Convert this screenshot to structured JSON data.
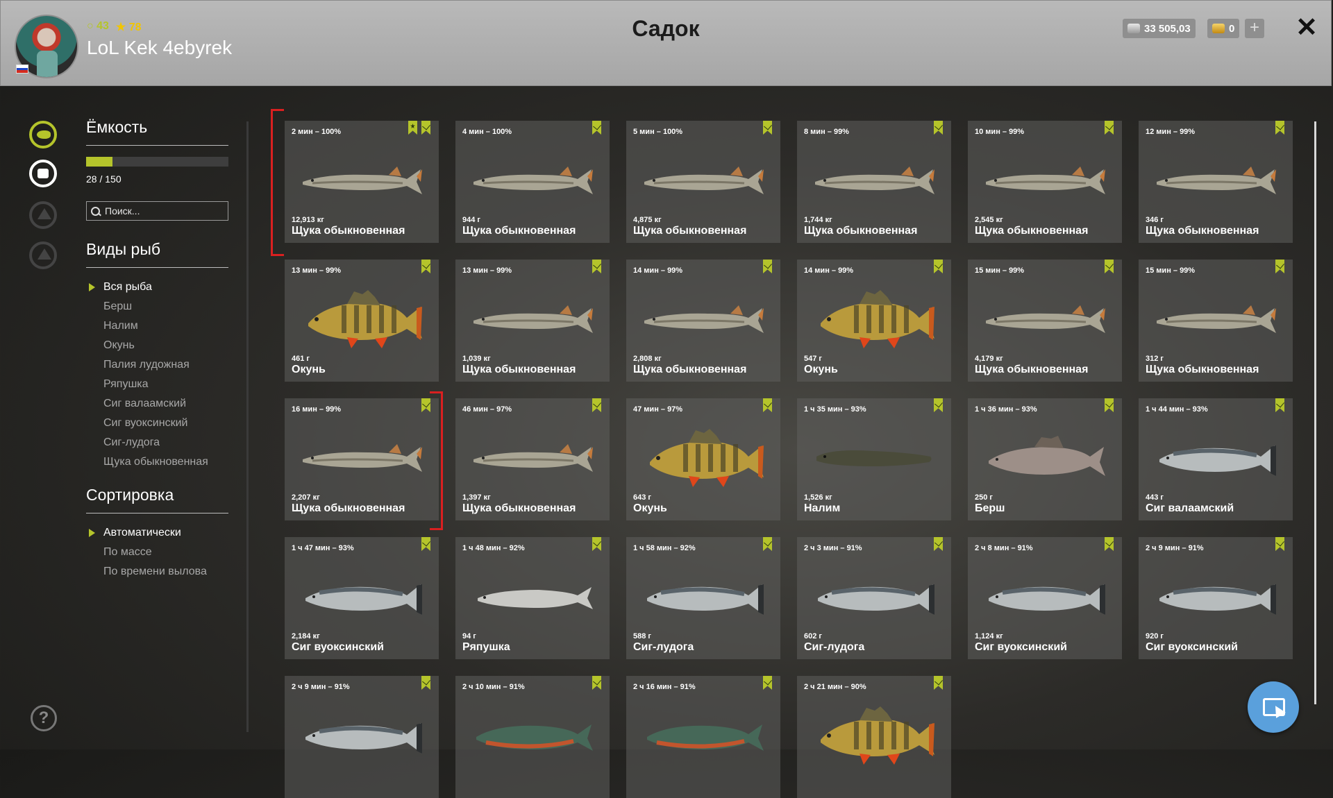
{
  "header": {
    "title": "Садок",
    "player": {
      "name": "LoL Kek 4ebyrek",
      "level": "43",
      "rank": "78"
    },
    "currency": {
      "silver": "33 505,03",
      "gold": "0"
    }
  },
  "sidebar": {
    "capacity": {
      "title": "Ёмкость",
      "text": "28 / 150",
      "fill": 0.187
    },
    "search": {
      "placeholder": "Поиск..."
    },
    "species": {
      "title": "Виды рыб",
      "items": [
        "Вся рыба",
        "Берш",
        "Налим",
        "Окунь",
        "Палия лудожная",
        "Ряпушка",
        "Сиг валаамский",
        "Сиг вуоксинский",
        "Сиг-лудога",
        "Щука обыкновенная"
      ],
      "active": 0
    },
    "sorting": {
      "title": "Сортировка",
      "items": [
        "Автоматически",
        "По массе",
        "По времени вылова"
      ],
      "active": 0
    }
  },
  "fish": [
    {
      "time": "2 мин – 100%",
      "weight": "12,913 кг",
      "name": "Щука обыкновенная",
      "kind": "pike",
      "starred": true
    },
    {
      "time": "4 мин – 100%",
      "weight": "944 г",
      "name": "Щука обыкновенная",
      "kind": "pike"
    },
    {
      "time": "5 мин – 100%",
      "weight": "4,875 кг",
      "name": "Щука обыкновенная",
      "kind": "pike"
    },
    {
      "time": "8 мин – 99%",
      "weight": "1,744 кг",
      "name": "Щука обыкновенная",
      "kind": "pike"
    },
    {
      "time": "10 мин – 99%",
      "weight": "2,545 кг",
      "name": "Щука обыкновенная",
      "kind": "pike"
    },
    {
      "time": "12 мин – 99%",
      "weight": "346 г",
      "name": "Щука обыкновенная",
      "kind": "pike"
    },
    {
      "time": "13 мин – 99%",
      "weight": "461 г",
      "name": "Окунь",
      "kind": "perch"
    },
    {
      "time": "13 мин – 99%",
      "weight": "1,039 кг",
      "name": "Щука обыкновенная",
      "kind": "pike"
    },
    {
      "time": "14 мин – 99%",
      "weight": "2,808 кг",
      "name": "Щука обыкновенная",
      "kind": "pike"
    },
    {
      "time": "14 мин – 99%",
      "weight": "547 г",
      "name": "Окунь",
      "kind": "perch"
    },
    {
      "time": "15 мин – 99%",
      "weight": "4,179 кг",
      "name": "Щука обыкновенная",
      "kind": "pike"
    },
    {
      "time": "15 мин – 99%",
      "weight": "312 г",
      "name": "Щука обыкновенная",
      "kind": "pike"
    },
    {
      "time": "16 мин – 99%",
      "weight": "2,207 кг",
      "name": "Щука обыкновенная",
      "kind": "pike"
    },
    {
      "time": "46 мин – 97%",
      "weight": "1,397 кг",
      "name": "Щука обыкновенная",
      "kind": "pike"
    },
    {
      "time": "47 мин – 97%",
      "weight": "643 г",
      "name": "Окунь",
      "kind": "perch"
    },
    {
      "time": "1 ч 35 мин – 93%",
      "weight": "1,526 кг",
      "name": "Налим",
      "kind": "burbot"
    },
    {
      "time": "1 ч 36 мин – 93%",
      "weight": "250 г",
      "name": "Берш",
      "kind": "bersh"
    },
    {
      "time": "1 ч 44 мин – 93%",
      "weight": "443 г",
      "name": "Сиг валаамский",
      "kind": "whitefish"
    },
    {
      "time": "1 ч 47 мин – 93%",
      "weight": "2,184 кг",
      "name": "Сиг вуоксинский",
      "kind": "whitefish"
    },
    {
      "time": "1 ч 48 мин – 92%",
      "weight": "94 г",
      "name": "Ряпушка",
      "kind": "vendace"
    },
    {
      "time": "1 ч 58 мин – 92%",
      "weight": "588 г",
      "name": "Сиг-лудога",
      "kind": "whitefish"
    },
    {
      "time": "2 ч 3 мин – 91%",
      "weight": "602 г",
      "name": "Сиг-лудога",
      "kind": "whitefish"
    },
    {
      "time": "2 ч 8 мин – 91%",
      "weight": "1,124 кг",
      "name": "Сиг вуоксинский",
      "kind": "whitefish"
    },
    {
      "time": "2 ч 9 мин – 91%",
      "weight": "920 г",
      "name": "Сиг вуоксинский",
      "kind": "whitefish"
    },
    {
      "time": "2 ч 9 мин – 91%",
      "weight": "",
      "name": "",
      "kind": "whitefish"
    },
    {
      "time": "2 ч 10 мин – 91%",
      "weight": "",
      "name": "",
      "kind": "char"
    },
    {
      "time": "2 ч 16 мин – 91%",
      "weight": "",
      "name": "",
      "kind": "char"
    },
    {
      "time": "2 ч 21 мин – 90%",
      "weight": "",
      "name": "",
      "kind": "perch"
    }
  ],
  "colors": {
    "accent": "#b5c42b",
    "highlight": "#d92020",
    "fab": "#5aa0dc"
  },
  "icons": [
    "fish-icon",
    "backpack-icon",
    "tent-icon",
    "home-icon",
    "help-icon",
    "cursor-mode-icon",
    "bookmark-icon",
    "star-icon",
    "close-icon",
    "plus-icon"
  ]
}
